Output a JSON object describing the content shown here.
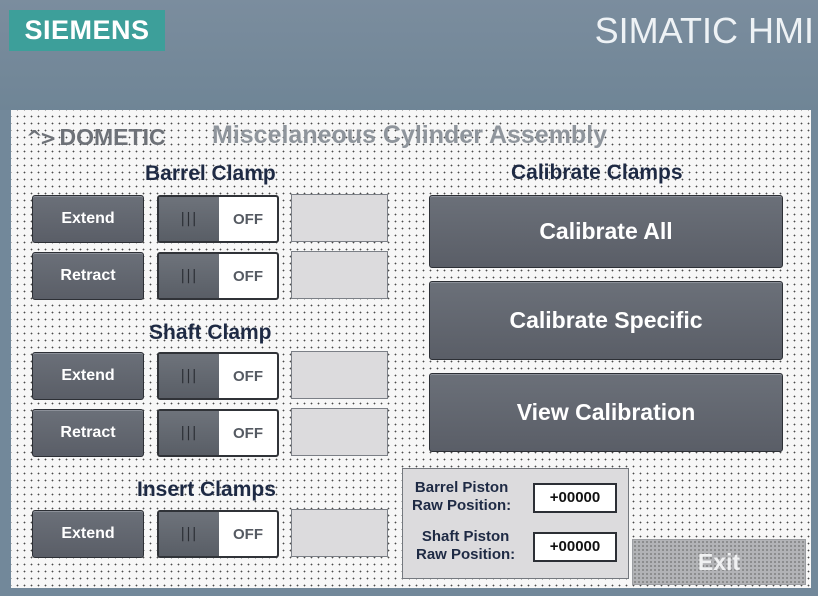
{
  "header": {
    "brand": "SIEMENS",
    "product": "SIMATIC HMI"
  },
  "screen": {
    "logo": {
      "mark": "^>",
      "name": "DOMETIC"
    },
    "title": "Miscelaneous Cylinder Assembly"
  },
  "sections": {
    "barrel": {
      "title": "Barrel Clamp"
    },
    "shaft": {
      "title": "Shaft Clamp"
    },
    "insert": {
      "title": "Insert Clamps"
    },
    "calibrate": {
      "title": "Calibrate Clamps"
    }
  },
  "rows": [
    {
      "button": "Extend",
      "state": "OFF"
    },
    {
      "button": "Retract",
      "state": "OFF"
    },
    {
      "button": "Extend",
      "state": "OFF"
    },
    {
      "button": "Retract",
      "state": "OFF"
    },
    {
      "button": "Extend",
      "state": "OFF"
    }
  ],
  "toggle_grip": "|||",
  "calibrate_buttons": [
    "Calibrate All",
    "Calibrate Specific",
    "View Calibration"
  ],
  "raw": {
    "barrel": {
      "label_line1": "Barrel Piston",
      "label_line2": "Raw Position:",
      "value": "+00000"
    },
    "shaft": {
      "label_line1": "Shaft Piston",
      "label_line2": "Raw Position:",
      "value": "+00000"
    }
  },
  "exit_label": "Exit",
  "colors": {
    "siemens_teal": "#3d9f9a",
    "button_gray": "#5f636c",
    "label_navy": "#1e2a44"
  }
}
